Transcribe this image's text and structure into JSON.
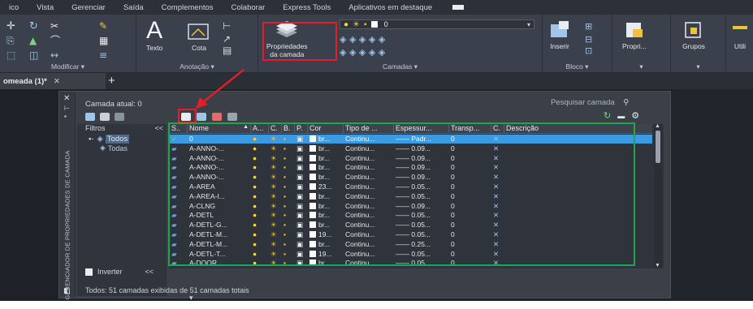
{
  "menu": [
    "ico",
    "Vista",
    "Gerenciar",
    "Saída",
    "Complementos",
    "Colaborar",
    "Express Tools",
    "Aplicativos em destaque"
  ],
  "ribbon": {
    "groups": {
      "modificar": "Modificar ▾",
      "anotacao": "Anotação ▾",
      "camadas": "Camadas ▾",
      "bloco": "Bloco ▾"
    },
    "buttons": {
      "texto": "Texto",
      "cota": "Cota",
      "propriedades_camada_1": "Propriedades",
      "propriedades_camada_2": "da camada",
      "inserir": "Inserir",
      "propri": "Propri...",
      "grupos": "Grupos",
      "util": "Utili"
    },
    "layer_combo_value": "0"
  },
  "tabs": {
    "active": "omeada (1)*",
    "close": "✕",
    "add": "+"
  },
  "palette": {
    "vertical_title": "GERENCIADOR DE PROPRIEDADES DE CAMADA",
    "current_layer": "Camada atual: 0",
    "search_placeholder": "Pesquisar camada",
    "filters_header": "Filtros",
    "filters_collapse": "<<",
    "filters": {
      "all": "Todos",
      "sub": "Todas"
    },
    "invert_label": "Inverter",
    "invert_collapse": "<<",
    "status": "Todos: 51 camadas exibidas de 51 camadas totais"
  },
  "grid": {
    "headers": [
      "S..",
      "Nome",
      "▲",
      "A...",
      "C.",
      "B.",
      "P.",
      "Cor",
      "Tipo de ...",
      "Espessur...",
      "Transp...",
      "C.",
      "Descrição"
    ],
    "rows": [
      {
        "name": "0",
        "color": "br...",
        "linetype": "Continu...",
        "weight": "Padr...",
        "transp": "0",
        "selected": true,
        "current": true
      },
      {
        "name": "A-ANNO-...",
        "color": "br...",
        "linetype": "Continu...",
        "weight": "0.09...",
        "transp": "0"
      },
      {
        "name": "A-ANNO-...",
        "color": "br...",
        "linetype": "Continu...",
        "weight": "0.09...",
        "transp": "0"
      },
      {
        "name": "A-ANNO-...",
        "color": "br...",
        "linetype": "Continu...",
        "weight": "0.09...",
        "transp": "0"
      },
      {
        "name": "A-ANNO-...",
        "color": "br...",
        "linetype": "Continu...",
        "weight": "0.09...",
        "transp": "0"
      },
      {
        "name": "A-AREA",
        "color": "23...",
        "linetype": "Continu...",
        "weight": "0.05...",
        "transp": "0"
      },
      {
        "name": "A-AREA-I...",
        "color": "br...",
        "linetype": "Continu...",
        "weight": "0.05...",
        "transp": "0"
      },
      {
        "name": "A-CLNG",
        "color": "br...",
        "linetype": "Continu...",
        "weight": "0.09...",
        "transp": "0"
      },
      {
        "name": "A-DETL",
        "color": "br...",
        "linetype": "Continu...",
        "weight": "0.05...",
        "transp": "0"
      },
      {
        "name": "A-DETL-G...",
        "color": "br...",
        "linetype": "Continu...",
        "weight": "0.05...",
        "transp": "0"
      },
      {
        "name": "A-DETL-M...",
        "color": "19...",
        "linetype": "Continu...",
        "weight": "0.05...",
        "transp": "0"
      },
      {
        "name": "A-DETL-M...",
        "color": "br...",
        "linetype": "Continu...",
        "weight": "0.25...",
        "transp": "0"
      },
      {
        "name": "A-DETL-T...",
        "color": "19...",
        "linetype": "Continu...",
        "weight": "0.05...",
        "transp": "0"
      },
      {
        "name": "A-DOOR",
        "color": "br...",
        "linetype": "Continu...",
        "weight": "0.05...",
        "transp": "0"
      }
    ]
  },
  "colors": {
    "highlight_red": "#e41e26",
    "highlight_green": "#1aa84f",
    "selection_blue": "#3c9ae0"
  }
}
